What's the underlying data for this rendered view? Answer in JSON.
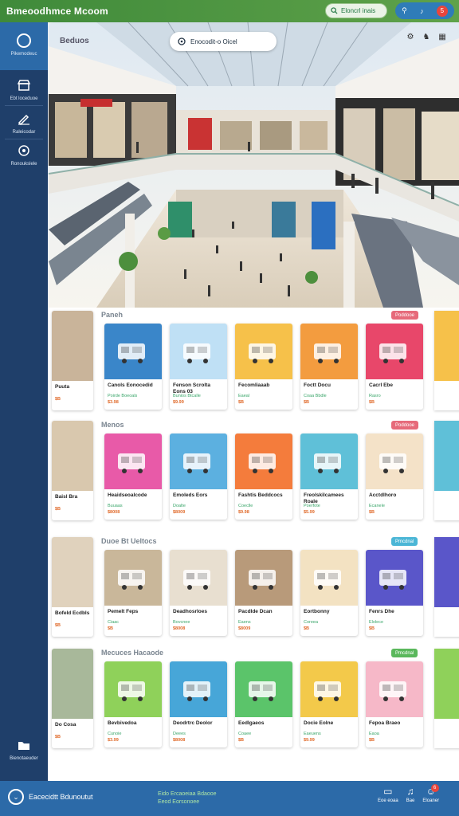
{
  "app": {
    "title": "Bmeoodhmce Mcoom"
  },
  "top": {
    "search_label": "Eloncrl inais",
    "notif_count": "5"
  },
  "sidebar": {
    "items": [
      {
        "label": "Pikemodeuc"
      },
      {
        "label": "Ebt loceduoe"
      },
      {
        "label": "Raleicodar"
      },
      {
        "label": "Ronoukslele"
      }
    ],
    "bottom_label": "Bienotaeuder"
  },
  "hero": {
    "label": "Beduos",
    "search": "Enocodit-o Oicel"
  },
  "sections": [
    {
      "title": "Paneh",
      "tag": "Poddooe",
      "tag_color": "#e66a7a",
      "cards": [
        {
          "name": "Puuta",
          "sub": "",
          "price": "$B"
        },
        {
          "name": "Canols Eonocedid",
          "sub": "Poirde Boeoals",
          "price": "$3.98"
        },
        {
          "name": "Fenson Scrolta Eons 03",
          "sub": "Bunios Btcalle",
          "price": "$9.99"
        },
        {
          "name": "Fecomliaaab",
          "sub": "Eaeal",
          "price": "$B"
        },
        {
          "name": "Foctt Docu",
          "sub": "Coaa Bbdle",
          "price": "$B"
        },
        {
          "name": "Cacrl Ebe",
          "sub": "Rasro",
          "price": "$B"
        }
      ]
    },
    {
      "title": "Menos",
      "tag": "Poddooe",
      "tag_color": "#e66a7a",
      "cards": [
        {
          "name": "Baisl Bra",
          "sub": "",
          "price": "$B"
        },
        {
          "name": "Heaidseoalcode",
          "sub": "Buuaas",
          "price": "$8008"
        },
        {
          "name": "Emoleds Eors",
          "sub": "Doalte",
          "price": "$8009"
        },
        {
          "name": "Fashtis Beddcocs",
          "sub": "Coeclle",
          "price": "$9.98"
        },
        {
          "name": "Freolskilcamees Roale",
          "sub": "Poerfote",
          "price": "$5.99"
        },
        {
          "name": "Acctdlhoro",
          "sub": "Ecanele",
          "price": "$B"
        }
      ]
    },
    {
      "title": "Duoe Bt Ueltocs",
      "tag": "Pmcdnal",
      "tag_color": "#4bb6d6",
      "cards": [
        {
          "name": "Bofeld Ecdbls",
          "sub": "",
          "price": "$B"
        },
        {
          "name": "Pemelt Feps",
          "sub": "Ciaac",
          "price": "$B"
        },
        {
          "name": "Deadhosrloes",
          "sub": "Bovcnee",
          "price": "$8008"
        },
        {
          "name": "Pacdlde Dcan",
          "sub": "Eaens",
          "price": "$8009"
        },
        {
          "name": "Eortbonny",
          "sub": "Coreea",
          "price": "$B"
        },
        {
          "name": "Fenrs Dhe",
          "sub": "Elolece",
          "price": "$B"
        }
      ]
    },
    {
      "title": "Mecuces Hacaode",
      "tag": "Pmcdnal",
      "tag_color": "#5ab85c",
      "cards": [
        {
          "name": "Do Cosa",
          "sub": "",
          "price": "$B"
        },
        {
          "name": "Bevbivedoa",
          "sub": "Cunoie",
          "price": "$3.99"
        },
        {
          "name": "Deodrtrc Deolor",
          "sub": "Deees",
          "price": "$8008"
        },
        {
          "name": "Eedlgaeos",
          "sub": "Coaee",
          "price": "$B"
        },
        {
          "name": "Docie Eolne",
          "sub": "Eaeuens",
          "price": "$9.99"
        },
        {
          "name": "Fepoa Braeo",
          "sub": "Eaoa",
          "price": "$B"
        }
      ]
    }
  ],
  "bottom": {
    "title": "Eacecidtt Bdunoutut",
    "mid_line1": "Eido  Ercaoeiaa  Bdaooe",
    "mid_line2": "Eeod  Eorsonoee",
    "items": [
      {
        "label": "Eoe eoaa"
      },
      {
        "label": "Bae"
      },
      {
        "label": "Eloaner"
      }
    ],
    "badge": "6"
  },
  "colors": {
    "topbar": "#4a9440",
    "sidebar": "#1f3f6a",
    "accent": "#2c6aa8"
  }
}
